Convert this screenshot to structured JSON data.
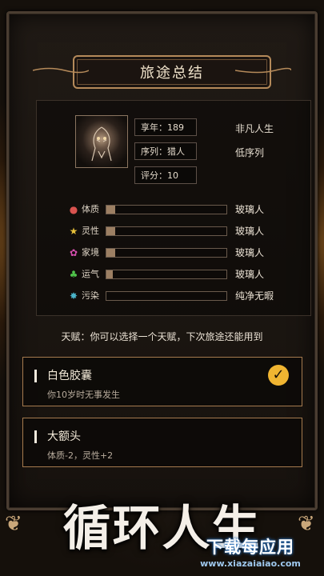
{
  "header": {
    "title": "旅途总结"
  },
  "profile": {
    "age": "享年：189",
    "sequence": "序列：猎人",
    "score": "评分：10",
    "rank": "非凡人生",
    "sequence_level": "低序列"
  },
  "stats": [
    {
      "icon": "muscle-icon",
      "label": "体质",
      "value": "玻璃人",
      "level": 0.07,
      "color": "#d9534f"
    },
    {
      "icon": "star-icon",
      "label": "灵性",
      "value": "玻璃人",
      "level": 0.07,
      "color": "#e8c13a"
    },
    {
      "icon": "brain-icon",
      "label": "家境",
      "value": "玻璃人",
      "level": 0.07,
      "color": "#d84fb0"
    },
    {
      "icon": "clover-icon",
      "label": "运气",
      "value": "玻璃人",
      "level": 0.05,
      "color": "#4fc34a"
    },
    {
      "icon": "virus-icon",
      "label": "污染",
      "value": "纯净无暇",
      "level": 0.0,
      "color": "#4ab3c9"
    }
  ],
  "talent": {
    "hint": "天赋：你可以选择一个天赋，下次旅途还能用到",
    "cards": [
      {
        "name": "白色胶囊",
        "desc": "你10岁时无事发生",
        "selected": true
      },
      {
        "name": "大额头",
        "desc": "体质-2，灵性+2",
        "selected": false
      }
    ]
  },
  "banner": {
    "title": "循环人生"
  },
  "watermark": {
    "main": "下载每应用",
    "url": "www.xiazaiaiao.com"
  }
}
